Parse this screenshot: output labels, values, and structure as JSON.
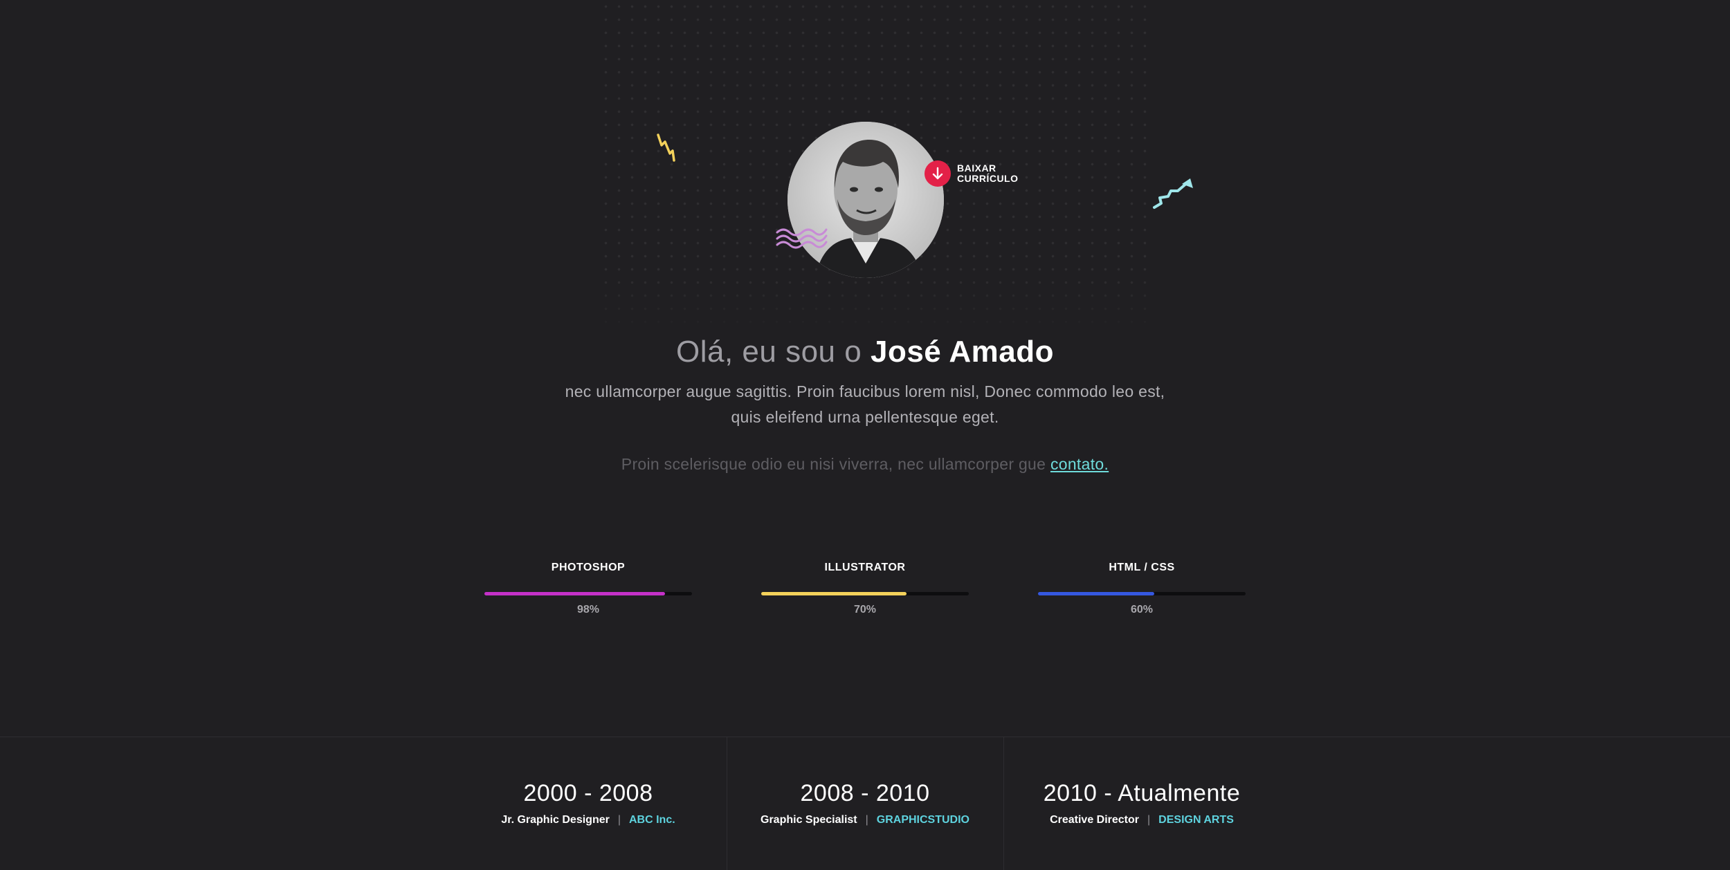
{
  "hero": {
    "greeting": "Olá, eu sou o",
    "name": "José Amado",
    "lead_line1": "nec ullamcorper augue sagittis. Proin faucibus lorem nisl, Donec commodo leo est,",
    "lead_line2": "quis eleifend urna pellentesque eget.",
    "contact_text": "Proin scelerisque odio eu nisi viverra, nec ullamcorper gue",
    "contact_link": "contato.",
    "download_line1": "BAIXAR",
    "download_line2": "CURRÍCULO",
    "download_icon": "arrow-down-icon"
  },
  "skills": [
    {
      "name": "PHOTOSHOP",
      "percent_label": "98%",
      "level": 0.87,
      "color": "#c531c9"
    },
    {
      "name": "ILLUSTRATOR",
      "percent_label": "70%",
      "level": 0.7,
      "color": "#f3d15b"
    },
    {
      "name": "HTML / CSS",
      "percent_label": "60%",
      "level": 0.56,
      "color": "#3558e0"
    }
  ],
  "experience": [
    {
      "years": "2000 - 2008",
      "role": "Jr. Graphic Designer",
      "separator": "|",
      "company": "ABC Inc."
    },
    {
      "years": "2008 - 2010",
      "role": "Graphic Specialist",
      "separator": "|",
      "company": "GRAPHICSTUDIO"
    },
    {
      "years": "2010 - Atualmente",
      "role": "Creative Director",
      "separator": "|",
      "company": "DESIGN ARTS"
    }
  ],
  "colors": {
    "background": "#201f22",
    "accent_red": "#e32148",
    "accent_cyan": "#6fdcdc",
    "bolt_yellow": "#f3d15b",
    "wave_lilac": "#c88bd6",
    "arrow_cyan": "#9fe6ea"
  },
  "icons": [
    "lightning-icon",
    "wave-icon",
    "zigzag-arrow-icon",
    "arrow-down-icon"
  ]
}
